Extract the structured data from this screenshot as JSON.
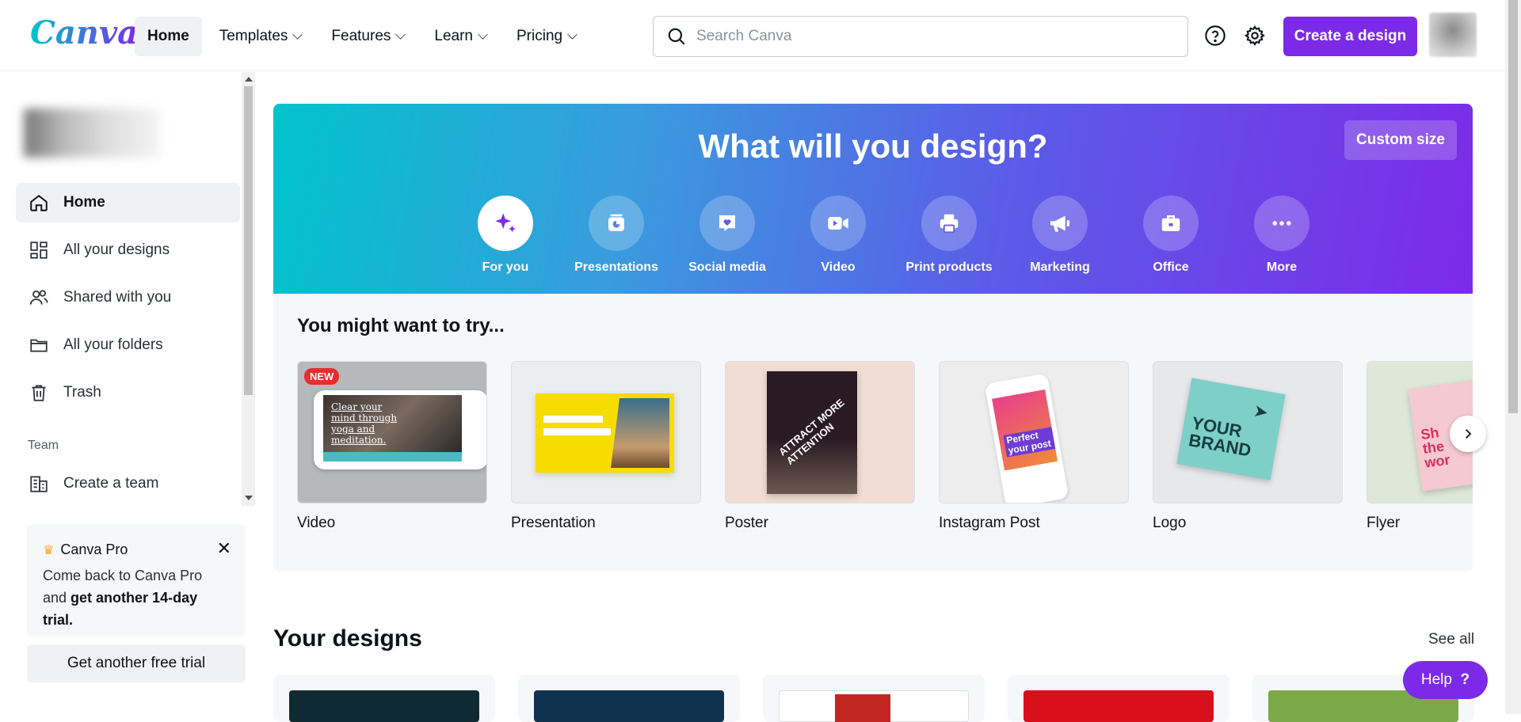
{
  "app": {
    "logo": "Canva"
  },
  "nav": {
    "items": [
      {
        "label": "Home",
        "active": true,
        "dropdown": false
      },
      {
        "label": "Templates",
        "dropdown": true
      },
      {
        "label": "Features",
        "dropdown": true
      },
      {
        "label": "Learn",
        "dropdown": true
      },
      {
        "label": "Pricing",
        "dropdown": true
      }
    ]
  },
  "search": {
    "placeholder": "Search Canva",
    "value": ""
  },
  "header": {
    "create_label": "Create a design",
    "help_icon": "help-icon",
    "settings_icon": "gear-icon"
  },
  "sidebar": {
    "items": [
      {
        "label": "Home",
        "icon": "home-icon",
        "active": true
      },
      {
        "label": "All your designs",
        "icon": "grid-icon"
      },
      {
        "label": "Shared with you",
        "icon": "users-icon"
      },
      {
        "label": "All your folders",
        "icon": "folder-icon"
      },
      {
        "label": "Trash",
        "icon": "trash-icon"
      }
    ],
    "team_label": "Team",
    "team_item": {
      "label": "Create a team",
      "icon": "building-icon"
    },
    "promo": {
      "title": "Canva Pro",
      "text_plain": "Come back to Canva Pro and ",
      "text_bold": "get another 14-day trial."
    },
    "trial_button": "Get another free trial"
  },
  "hero": {
    "title": "What will you design?",
    "custom_size": "Custom size",
    "categories": [
      {
        "label": "For you",
        "icon": "sparkle-icon",
        "active": true
      },
      {
        "label": "Presentations",
        "icon": "presentation-icon"
      },
      {
        "label": "Social media",
        "icon": "heart-icon"
      },
      {
        "label": "Video",
        "icon": "video-icon"
      },
      {
        "label": "Print products",
        "icon": "printer-icon"
      },
      {
        "label": "Marketing",
        "icon": "megaphone-icon"
      },
      {
        "label": "Office",
        "icon": "briefcase-icon"
      },
      {
        "label": "More",
        "icon": "more-icon"
      }
    ]
  },
  "try": {
    "title": "You might want to try...",
    "badge": "NEW",
    "tiles": [
      {
        "label": "Video",
        "thumb_text": "Clear your mind through yoga and meditation."
      },
      {
        "label": "Presentation"
      },
      {
        "label": "Poster",
        "thumb_text": "ATTRACT MORE ATTENTION"
      },
      {
        "label": "Instagram Post",
        "thumb_text": "Perfect your post"
      },
      {
        "label": "Logo",
        "thumb_text": "YOUR BRAND"
      },
      {
        "label": "Flyer",
        "thumb_text": "Sh the wor"
      }
    ]
  },
  "designs": {
    "title": "Your designs",
    "see_all": "See all"
  },
  "help": {
    "label": "Help",
    "symbol": "?"
  },
  "colors": {
    "accent": "#7d2ae8",
    "teal": "#00c4cc"
  }
}
